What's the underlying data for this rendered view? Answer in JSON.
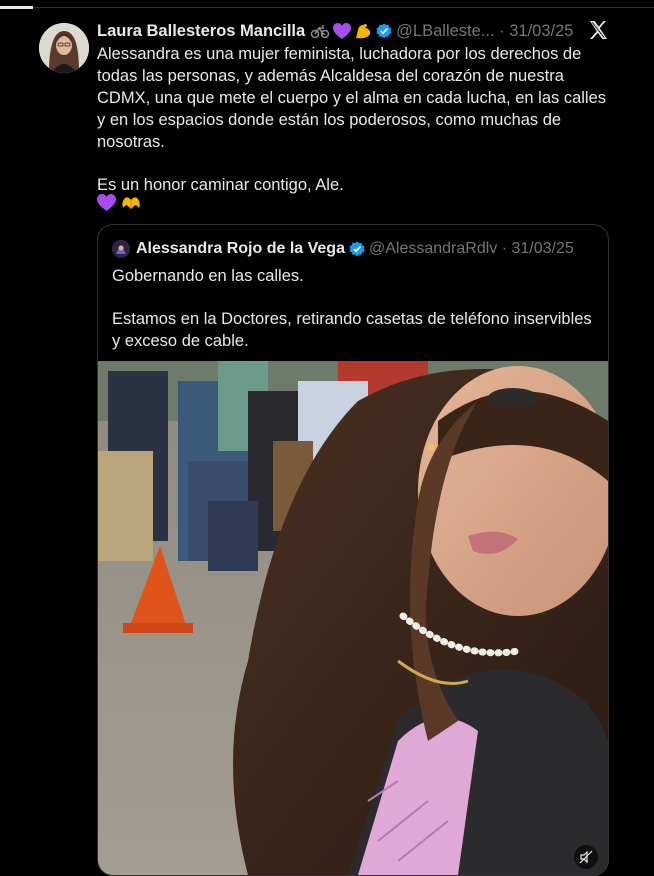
{
  "tweet": {
    "author_name": "Laura Ballesteros Mancilla",
    "name_emojis": [
      "bicycle-emoji",
      "purple-heart-emoji",
      "flexed-biceps-emoji"
    ],
    "handle_date": "@LBalleste... · 31/03/25",
    "body": [
      "Alessandra es una mujer feminista, luchadora por los derechos de todas las personas, y además Alcaldesa del corazón de nuestra CDMX, una que mete el cuerpo y el alma en cada lucha, en las calles y en los espacios donde están los poderosos, como muchas de nosotras.",
      "Es un honor caminar contigo, Ale."
    ],
    "trailing_emojis": [
      "purple-heart-emoji",
      "heart-hands-emoji"
    ]
  },
  "quoted": {
    "author_name": "Alessandra Rojo de la Vega",
    "handle_date": "@AlessandraRdlv · 31/03/25",
    "body": [
      "Gobernando en las calles.",
      "Estamos en la Doctores, retirando casetas de teléfono inservibles y exceso de cable."
    ]
  },
  "colors": {
    "background": "#000000",
    "text": "#e7e9ea",
    "muted": "#71767b",
    "border": "#2f3336",
    "verified": "#1d9bf0",
    "purple_heart": "#a64cf0",
    "arm_emoji": "#f5b400"
  }
}
